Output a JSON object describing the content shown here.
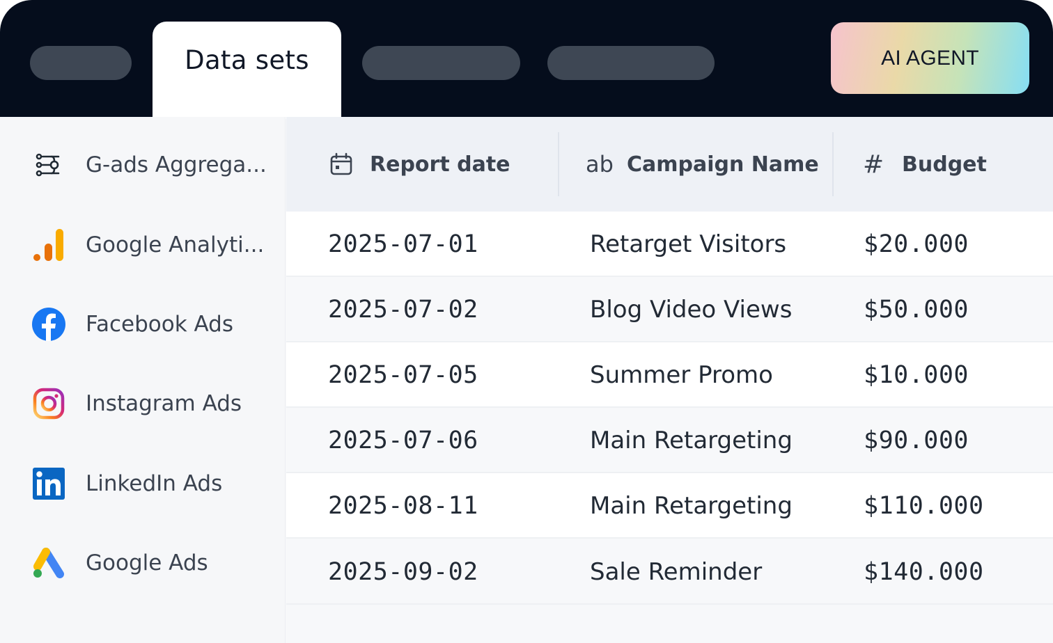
{
  "tabs": {
    "active_label": "Data sets"
  },
  "agent_button": {
    "label": "AI AGENT"
  },
  "sidebar": {
    "items": [
      {
        "label": "G-ads Aggrega...",
        "icon": "aggregation-icon"
      },
      {
        "label": "Google Analyti...",
        "icon": "google-analytics-icon"
      },
      {
        "label": "Facebook Ads",
        "icon": "facebook-icon"
      },
      {
        "label": "Instagram Ads",
        "icon": "instagram-icon"
      },
      {
        "label": "LinkedIn Ads",
        "icon": "linkedin-icon"
      },
      {
        "label": "Google Ads",
        "icon": "google-ads-icon"
      }
    ]
  },
  "table": {
    "columns": [
      {
        "label": "Report date",
        "icon": "calendar-icon"
      },
      {
        "label": "Campaign Name",
        "icon": "text-type-icon",
        "icon_text": "ab"
      },
      {
        "label": "Budget",
        "icon": "number-type-icon",
        "icon_text": "#"
      }
    ],
    "rows": [
      {
        "date": "2025-07-01",
        "campaign": "Retarget Visitors",
        "budget": "$20.000"
      },
      {
        "date": "2025-07-02",
        "campaign": "Blog Video Views",
        "budget": "$50.000"
      },
      {
        "date": "2025-07-05",
        "campaign": "Summer Promo",
        "budget": "$10.000"
      },
      {
        "date": "2025-07-06",
        "campaign": "Main Retargeting",
        "budget": "$90.000"
      },
      {
        "date": "2025-08-11",
        "campaign": "Main Retargeting",
        "budget": "$110.000"
      },
      {
        "date": "2025-09-02",
        "campaign": "Sale Reminder",
        "budget": "$140.000"
      }
    ]
  },
  "colors": {
    "topbar": "#050d1c",
    "pill": "#3e4754",
    "facebook": "#1877f2",
    "linkedin": "#0a66c2"
  }
}
